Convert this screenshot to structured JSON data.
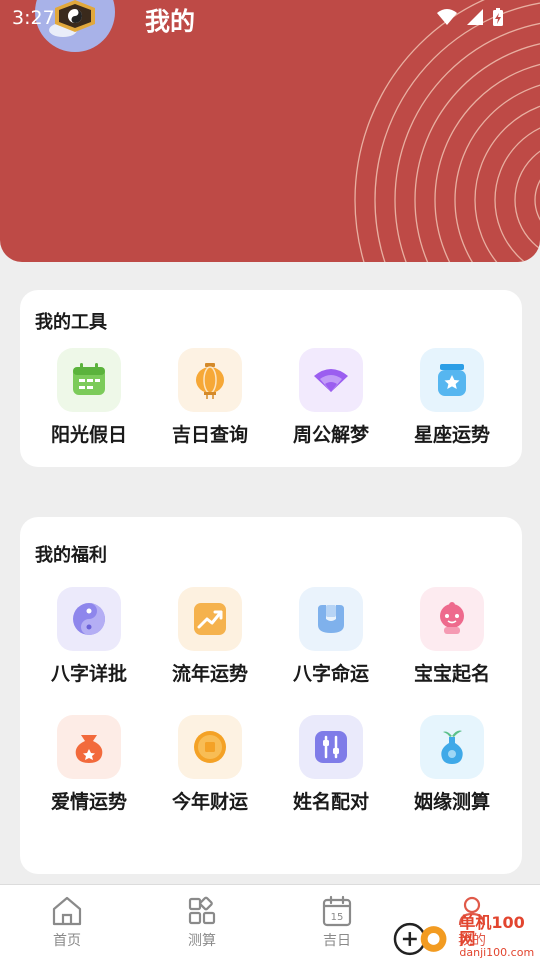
{
  "status_bar": {
    "time": "3:27"
  },
  "header": {
    "title": "我的"
  },
  "tools": {
    "title": "我的工具",
    "items": [
      {
        "label": "阳光假日",
        "icon": "calendar-icon"
      },
      {
        "label": "吉日查询",
        "icon": "lantern-icon"
      },
      {
        "label": "周公解梦",
        "icon": "fan-icon"
      },
      {
        "label": "星座运势",
        "icon": "star-jar-icon"
      }
    ]
  },
  "benefits": {
    "title": "我的福利",
    "items": [
      {
        "label": "八字详批",
        "icon": "yin-yang-icon"
      },
      {
        "label": "流年运势",
        "icon": "trend-chart-icon"
      },
      {
        "label": "八字命运",
        "icon": "couplet-icon"
      },
      {
        "label": "宝宝起名",
        "icon": "baby-icon"
      },
      {
        "label": "爱情运势",
        "icon": "love-pouch-icon"
      },
      {
        "label": "今年财运",
        "icon": "coin-icon"
      },
      {
        "label": "姓名配对",
        "icon": "pairing-icon"
      },
      {
        "label": "姻缘测算",
        "icon": "vase-icon"
      }
    ]
  },
  "bottom_nav": {
    "items": [
      {
        "label": "首页",
        "icon": "home-icon"
      },
      {
        "label": "测算",
        "icon": "grid-icon"
      },
      {
        "label": "吉日",
        "icon": "calendar-15-icon",
        "day": "15"
      },
      {
        "label": "我的",
        "icon": "person-icon",
        "active": true
      }
    ]
  },
  "watermark": {
    "name": "单机100网",
    "url": "danji100.com"
  },
  "colors": {
    "header_bg": "#be4a46",
    "page_bg": "#eeeeee",
    "card_bg": "#ffffff",
    "nav_text": "#8a8a8a",
    "watermark": "#e2452f"
  }
}
